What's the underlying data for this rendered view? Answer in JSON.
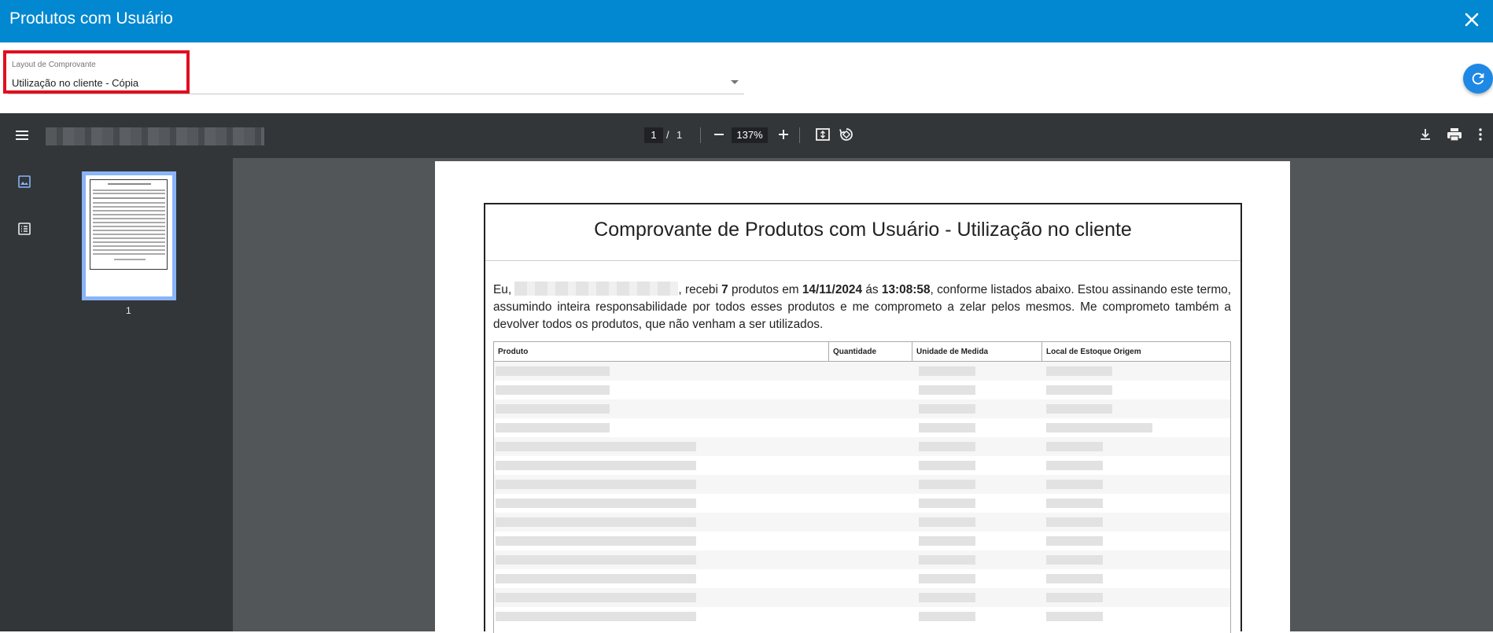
{
  "dialog": {
    "title": "Produtos com Usuário"
  },
  "form": {
    "layout_label": "Layout de Comprovante",
    "layout_value": "Utilização no cliente - Cópia"
  },
  "pdf_toolbar": {
    "current_page": "1",
    "separator": "/",
    "total_pages": "1",
    "zoom": "137%"
  },
  "sidebar": {
    "thumbnail_label": "1"
  },
  "document": {
    "title": "Comprovante de Produtos com Usuário - Utilização no cliente",
    "para_prefix": "Eu, ",
    "para_received": ", recebi ",
    "para_count": "7",
    "para_products_em": " produtos em ",
    "para_date": "14/11/2024",
    "para_as": " ás ",
    "para_time": "13:08:58",
    "para_rest": ", conforme listados abaixo. Estou assinando este termo, assumindo inteira responsabilidade por todos esses produtos e me comprometo a zelar pelos mesmos. Me comprometo também a devolver todos os produtos, que não venham a ser utilizados.",
    "table_headers": [
      "Produto",
      "Quantidade",
      "Unidade de Medida",
      "Local de Estoque Origem"
    ]
  },
  "colors": {
    "header_bg": "#0288d1",
    "highlight": "#e0101e",
    "toolbar_bg": "#323639",
    "canvas_bg": "#525659"
  }
}
